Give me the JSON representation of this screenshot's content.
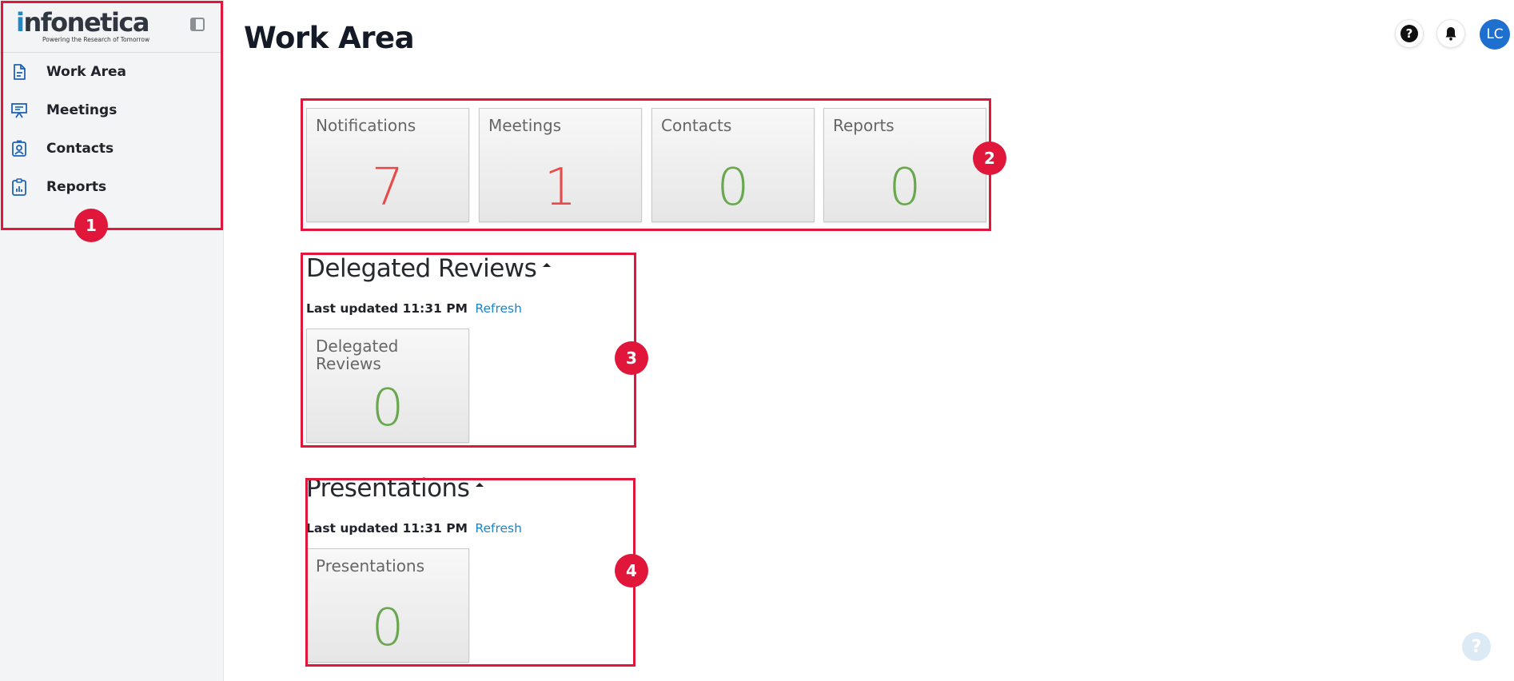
{
  "brand": {
    "logo_text": "infonetica",
    "tagline": "Powering the Research of Tomorrow"
  },
  "sidebar": {
    "items": [
      {
        "label": "Work Area",
        "icon": "document-icon"
      },
      {
        "label": "Meetings",
        "icon": "presentation-icon"
      },
      {
        "label": "Contacts",
        "icon": "contact-card-icon"
      },
      {
        "label": "Reports",
        "icon": "clipboard-chart-icon"
      }
    ]
  },
  "header": {
    "title": "Work Area",
    "avatar_initials": "LC"
  },
  "summary_tiles": [
    {
      "label": "Notifications",
      "value": "7",
      "color": "#e84a4a"
    },
    {
      "label": "Meetings",
      "value": "1",
      "color": "#e84a4a"
    },
    {
      "label": "Contacts",
      "value": "0",
      "color": "#6aa84f"
    },
    {
      "label": "Reports",
      "value": "0",
      "color": "#6aa84f"
    }
  ],
  "delegated_reviews": {
    "title": "Delegated Reviews",
    "last_updated": "Last updated 11:31 PM",
    "refresh_label": "Refresh",
    "tile": {
      "label": "Delegated Reviews",
      "value": "0",
      "color": "#6aa84f"
    }
  },
  "presentations": {
    "title": "Presentations",
    "last_updated": "Last updated 11:31 PM",
    "refresh_label": "Refresh",
    "tile": {
      "label": "Presentations",
      "value": "0",
      "color": "#6aa84f"
    }
  },
  "annotations": [
    "1",
    "2",
    "3",
    "4"
  ],
  "colors": {
    "accent": "#1f6fcf",
    "annotation": "#e0173a",
    "link": "#1a86c7"
  }
}
